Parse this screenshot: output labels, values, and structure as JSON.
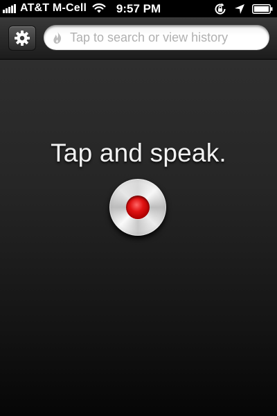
{
  "status_bar": {
    "carrier": "AT&T M-Cell",
    "time": "9:57 PM",
    "icons": [
      "signal-icon",
      "wifi-icon",
      "rotation-lock-icon",
      "location-icon",
      "battery-icon"
    ]
  },
  "header": {
    "settings_icon": "gear-icon",
    "search": {
      "placeholder": "Tap to search or view history",
      "value": "",
      "icon": "flame-icon"
    }
  },
  "main": {
    "prompt": "Tap and speak.",
    "record_button_icon": "record-icon"
  },
  "colors": {
    "record_red": "#d01010",
    "background": "#1a1a1a",
    "text": "#f2f2f2"
  }
}
